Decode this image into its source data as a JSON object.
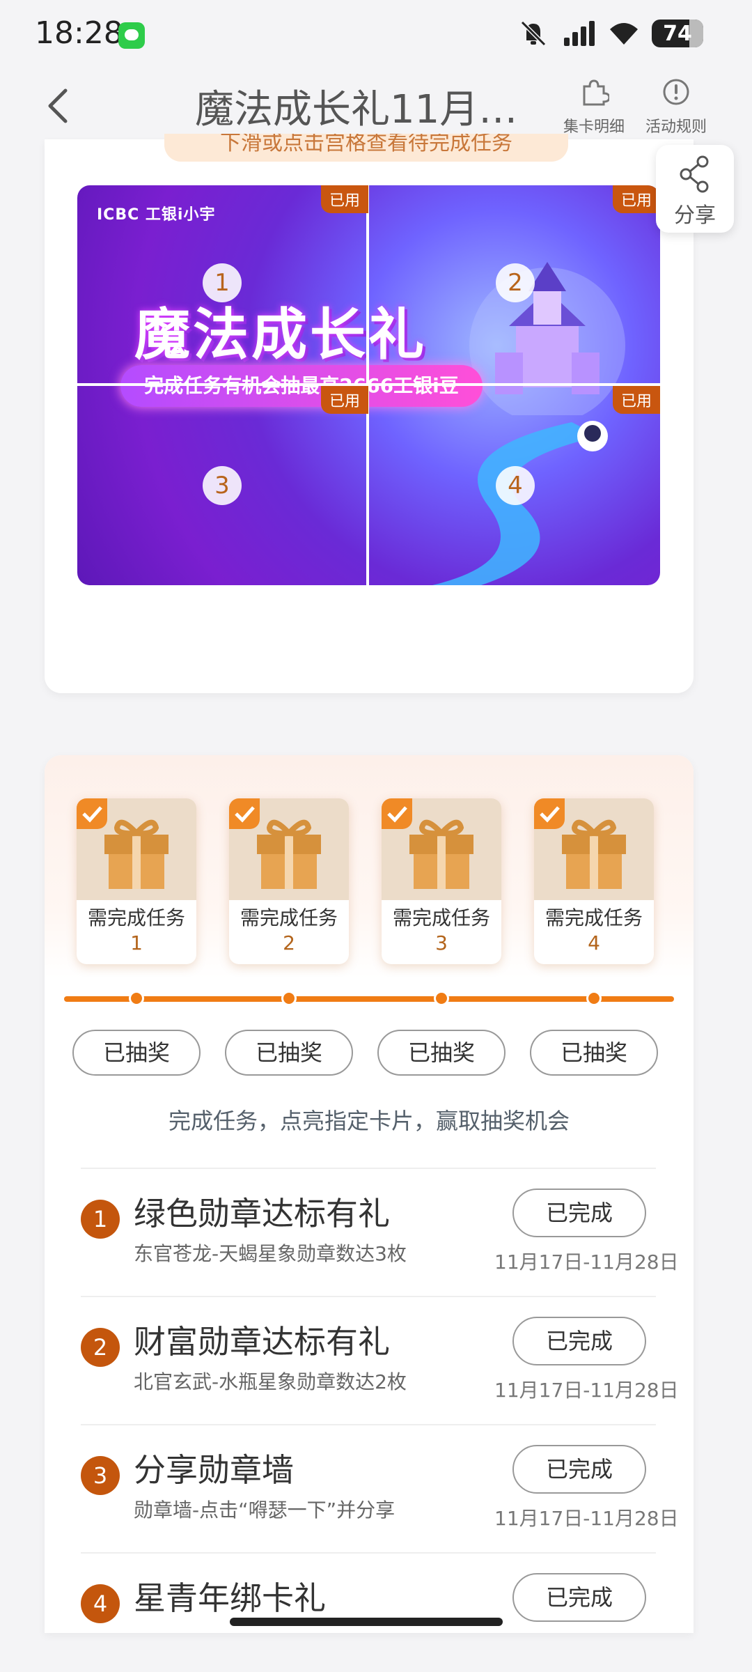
{
  "status_bar": {
    "time": "18:28",
    "battery": "74"
  },
  "header": {
    "title": "魔法成长礼11月第...",
    "collect_detail": "集卡明细",
    "activity_rules": "活动规则"
  },
  "hint": "下滑或点击宫格查看待完成任务",
  "share": {
    "label": "分享"
  },
  "puzzle": {
    "brand": "ICBC 工银i小宇",
    "title": "魔法成长礼",
    "subtitle": "完成任务有机会抽最高2666工银i豆",
    "cells": [
      {
        "num": "1",
        "badge": "已用"
      },
      {
        "num": "2",
        "badge": "已用"
      },
      {
        "num": "3",
        "badge": "已用"
      },
      {
        "num": "4",
        "badge": "已用"
      }
    ]
  },
  "gifts": [
    {
      "label": "需完成任务",
      "num": "1",
      "button": "已抽奖"
    },
    {
      "label": "需完成任务",
      "num": "2",
      "button": "已抽奖"
    },
    {
      "label": "需完成任务",
      "num": "3",
      "button": "已抽奖"
    },
    {
      "label": "需完成任务",
      "num": "4",
      "button": "已抽奖"
    }
  ],
  "instruction": "完成任务，点亮指定卡片，赢取抽奖机会",
  "tasks": [
    {
      "num": "1",
      "name": "绿色勋章达标有礼",
      "desc": "东官苍龙-天蝎星象勋章数达3枚",
      "status": "已完成",
      "date": "11月17日-11月28日"
    },
    {
      "num": "2",
      "name": "财富勋章达标有礼",
      "desc": "北官玄武-水瓶星象勋章数达2枚",
      "status": "已完成",
      "date": "11月17日-11月28日"
    },
    {
      "num": "3",
      "name": "分享勋章墙",
      "desc": "勋章墙-点击“嘚瑟一下”并分享",
      "status": "已完成",
      "date": "11月17日-11月28日"
    },
    {
      "num": "4",
      "name": "星青年绑卡礼",
      "desc": "",
      "status": "已完成",
      "date": ""
    }
  ],
  "colors": {
    "accent": "#f07c14",
    "badge": "#c4560d",
    "used_tag": "#c9560f"
  }
}
